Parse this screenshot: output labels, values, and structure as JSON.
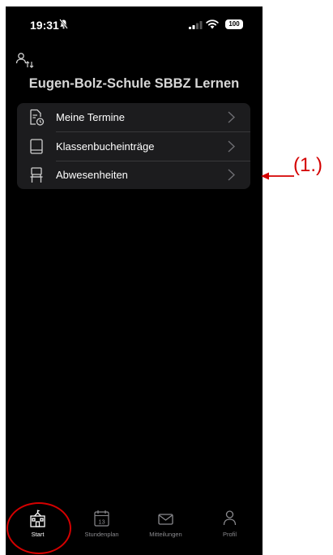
{
  "status_bar": {
    "time": "19:31",
    "battery_label": "100",
    "icons": [
      "bell-slash-icon",
      "signal-icon",
      "wifi-icon",
      "battery-icon"
    ]
  },
  "header": {
    "profile_switch_icon": "person-switch-icon",
    "school_name": "Eugen-Bolz-Schule SBBZ Lernen"
  },
  "menu": {
    "items": [
      {
        "label": "Meine Termine",
        "icon": "document-calendar-icon"
      },
      {
        "label": "Klassenbucheinträge",
        "icon": "book-icon"
      },
      {
        "label": "Abwesenheiten",
        "icon": "chair-icon"
      }
    ]
  },
  "tab_bar": {
    "active": "Start",
    "tabs": [
      {
        "label": "Start",
        "icon": "school-icon"
      },
      {
        "label": "Stundenplan",
        "icon": "calendar-icon",
        "calendar_day": "13"
      },
      {
        "label": "Mitteilungen",
        "icon": "envelope-icon"
      },
      {
        "label": "Profil",
        "icon": "person-icon"
      }
    ]
  },
  "annotation": {
    "label": "(1.)",
    "color": "#d40000"
  },
  "colors": {
    "background": "#000000",
    "card": "#1c1c1e",
    "annotation": "#d40000",
    "tab_inactive": "#8a8a8e"
  }
}
